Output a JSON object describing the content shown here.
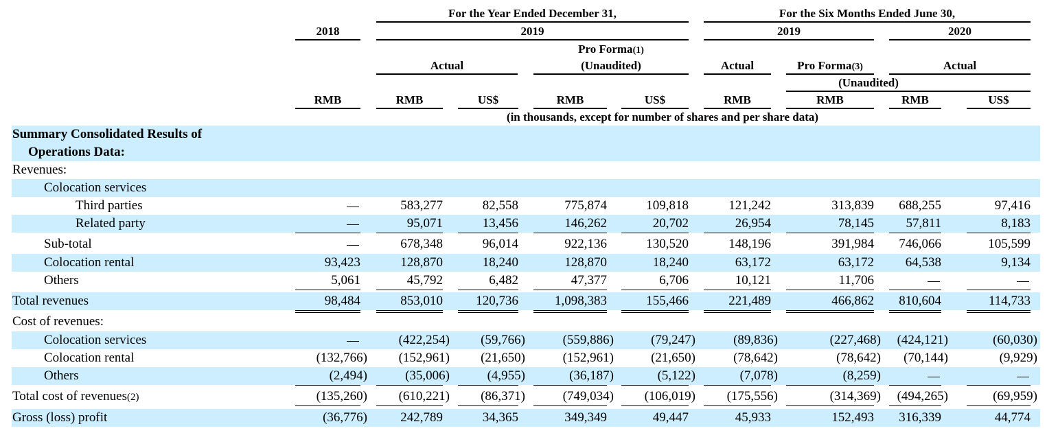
{
  "header": {
    "group_year": "For the Year Ended December 31,",
    "group_six": "For the Six Months Ended June 30,",
    "y2018": "2018",
    "y2019_a": "2019",
    "y2019_b": "2019",
    "y2020": "2020",
    "pro_forma_1": "Pro Forma",
    "pro_forma_1_note": "(1)",
    "unaudited_1": "(Unaudited)",
    "actual_a": "Actual",
    "actual_b": "Actual",
    "actual_c": "Actual",
    "pro_forma_3": "Pro Forma",
    "pro_forma_3_note": "(3)",
    "unaudited_3": "(Unaudited)",
    "currencies": [
      "RMB",
      "RMB",
      "US$",
      "RMB",
      "US$",
      "RMB",
      "RMB",
      "RMB",
      "US$"
    ],
    "units_note": "(in thousands, except for number of shares and per share data)"
  },
  "section": {
    "title_line1": "Summary Consolidated Results of",
    "title_line2": "Operations Data:"
  },
  "rows": [
    {
      "label": "Revenues:",
      "values": [
        "",
        "",
        "",
        "",
        "",
        "",
        "",
        "",
        ""
      ]
    },
    {
      "label": "Colocation services",
      "values": [
        "",
        "",
        "",
        "",
        "",
        "",
        "",
        "",
        ""
      ]
    },
    {
      "label": "Third parties",
      "values": [
        "—",
        "583,277",
        "82,558",
        "775,874",
        "109,818",
        "121,242",
        "313,839",
        "688,255",
        "97,416"
      ]
    },
    {
      "label": "Related party",
      "values": [
        "—",
        "95,071",
        "13,456",
        "146,262",
        "20,702",
        "26,954",
        "78,145",
        "57,811",
        "8,183"
      ]
    },
    {
      "label": "Sub-total",
      "values": [
        "—",
        "678,348",
        "96,014",
        "922,136",
        "130,520",
        "148,196",
        "391,984",
        "746,066",
        "105,599"
      ]
    },
    {
      "label": "Colocation rental",
      "values": [
        "93,423",
        "128,870",
        "18,240",
        "128,870",
        "18,240",
        "63,172",
        "63,172",
        "64,538",
        "9,134"
      ]
    },
    {
      "label": "Others",
      "values": [
        "5,061",
        "45,792",
        "6,482",
        "47,377",
        "6,706",
        "10,121",
        "11,706",
        "—",
        "—"
      ]
    },
    {
      "label": "Total revenues",
      "values": [
        "98,484",
        "853,010",
        "120,736",
        "1,098,383",
        "155,466",
        "221,489",
        "466,862",
        "810,604",
        "114,733"
      ]
    },
    {
      "label": "Cost of revenues:",
      "values": [
        "",
        "",
        "",
        "",
        "",
        "",
        "",
        "",
        ""
      ]
    },
    {
      "label": "Colocation services",
      "values": [
        "—",
        "(422,254)",
        "(59,766)",
        "(559,886)",
        "(79,247)",
        "(89,836)",
        "(227,468)",
        "(424,121)",
        "(60,030)"
      ]
    },
    {
      "label": "Colocation rental",
      "values": [
        "(132,766)",
        "(152,961)",
        "(21,650)",
        "(152,961)",
        "(21,650)",
        "(78,642)",
        "(78,642)",
        "(70,144)",
        "(9,929)"
      ]
    },
    {
      "label": "Others",
      "values": [
        "(2,494)",
        "(35,006)",
        "(4,955)",
        "(36,187)",
        "(5,122)",
        "(7,078)",
        "(8,259)",
        "—",
        "—"
      ]
    },
    {
      "label": "Total cost of revenues",
      "note": "(2)",
      "values": [
        "(135,260)",
        "(610,221)",
        "(86,371)",
        "(749,034)",
        "(106,019)",
        "(175,556)",
        "(314,369)",
        "(494,265)",
        "(69,959)"
      ]
    },
    {
      "label": "Gross (loss) profit",
      "values": [
        "(36,776)",
        "242,789",
        "34,365",
        "349,349",
        "49,447",
        "45,933",
        "152,493",
        "316,339",
        "44,774"
      ]
    }
  ],
  "colors": {
    "band": "#cceeff",
    "text": "#000000"
  }
}
